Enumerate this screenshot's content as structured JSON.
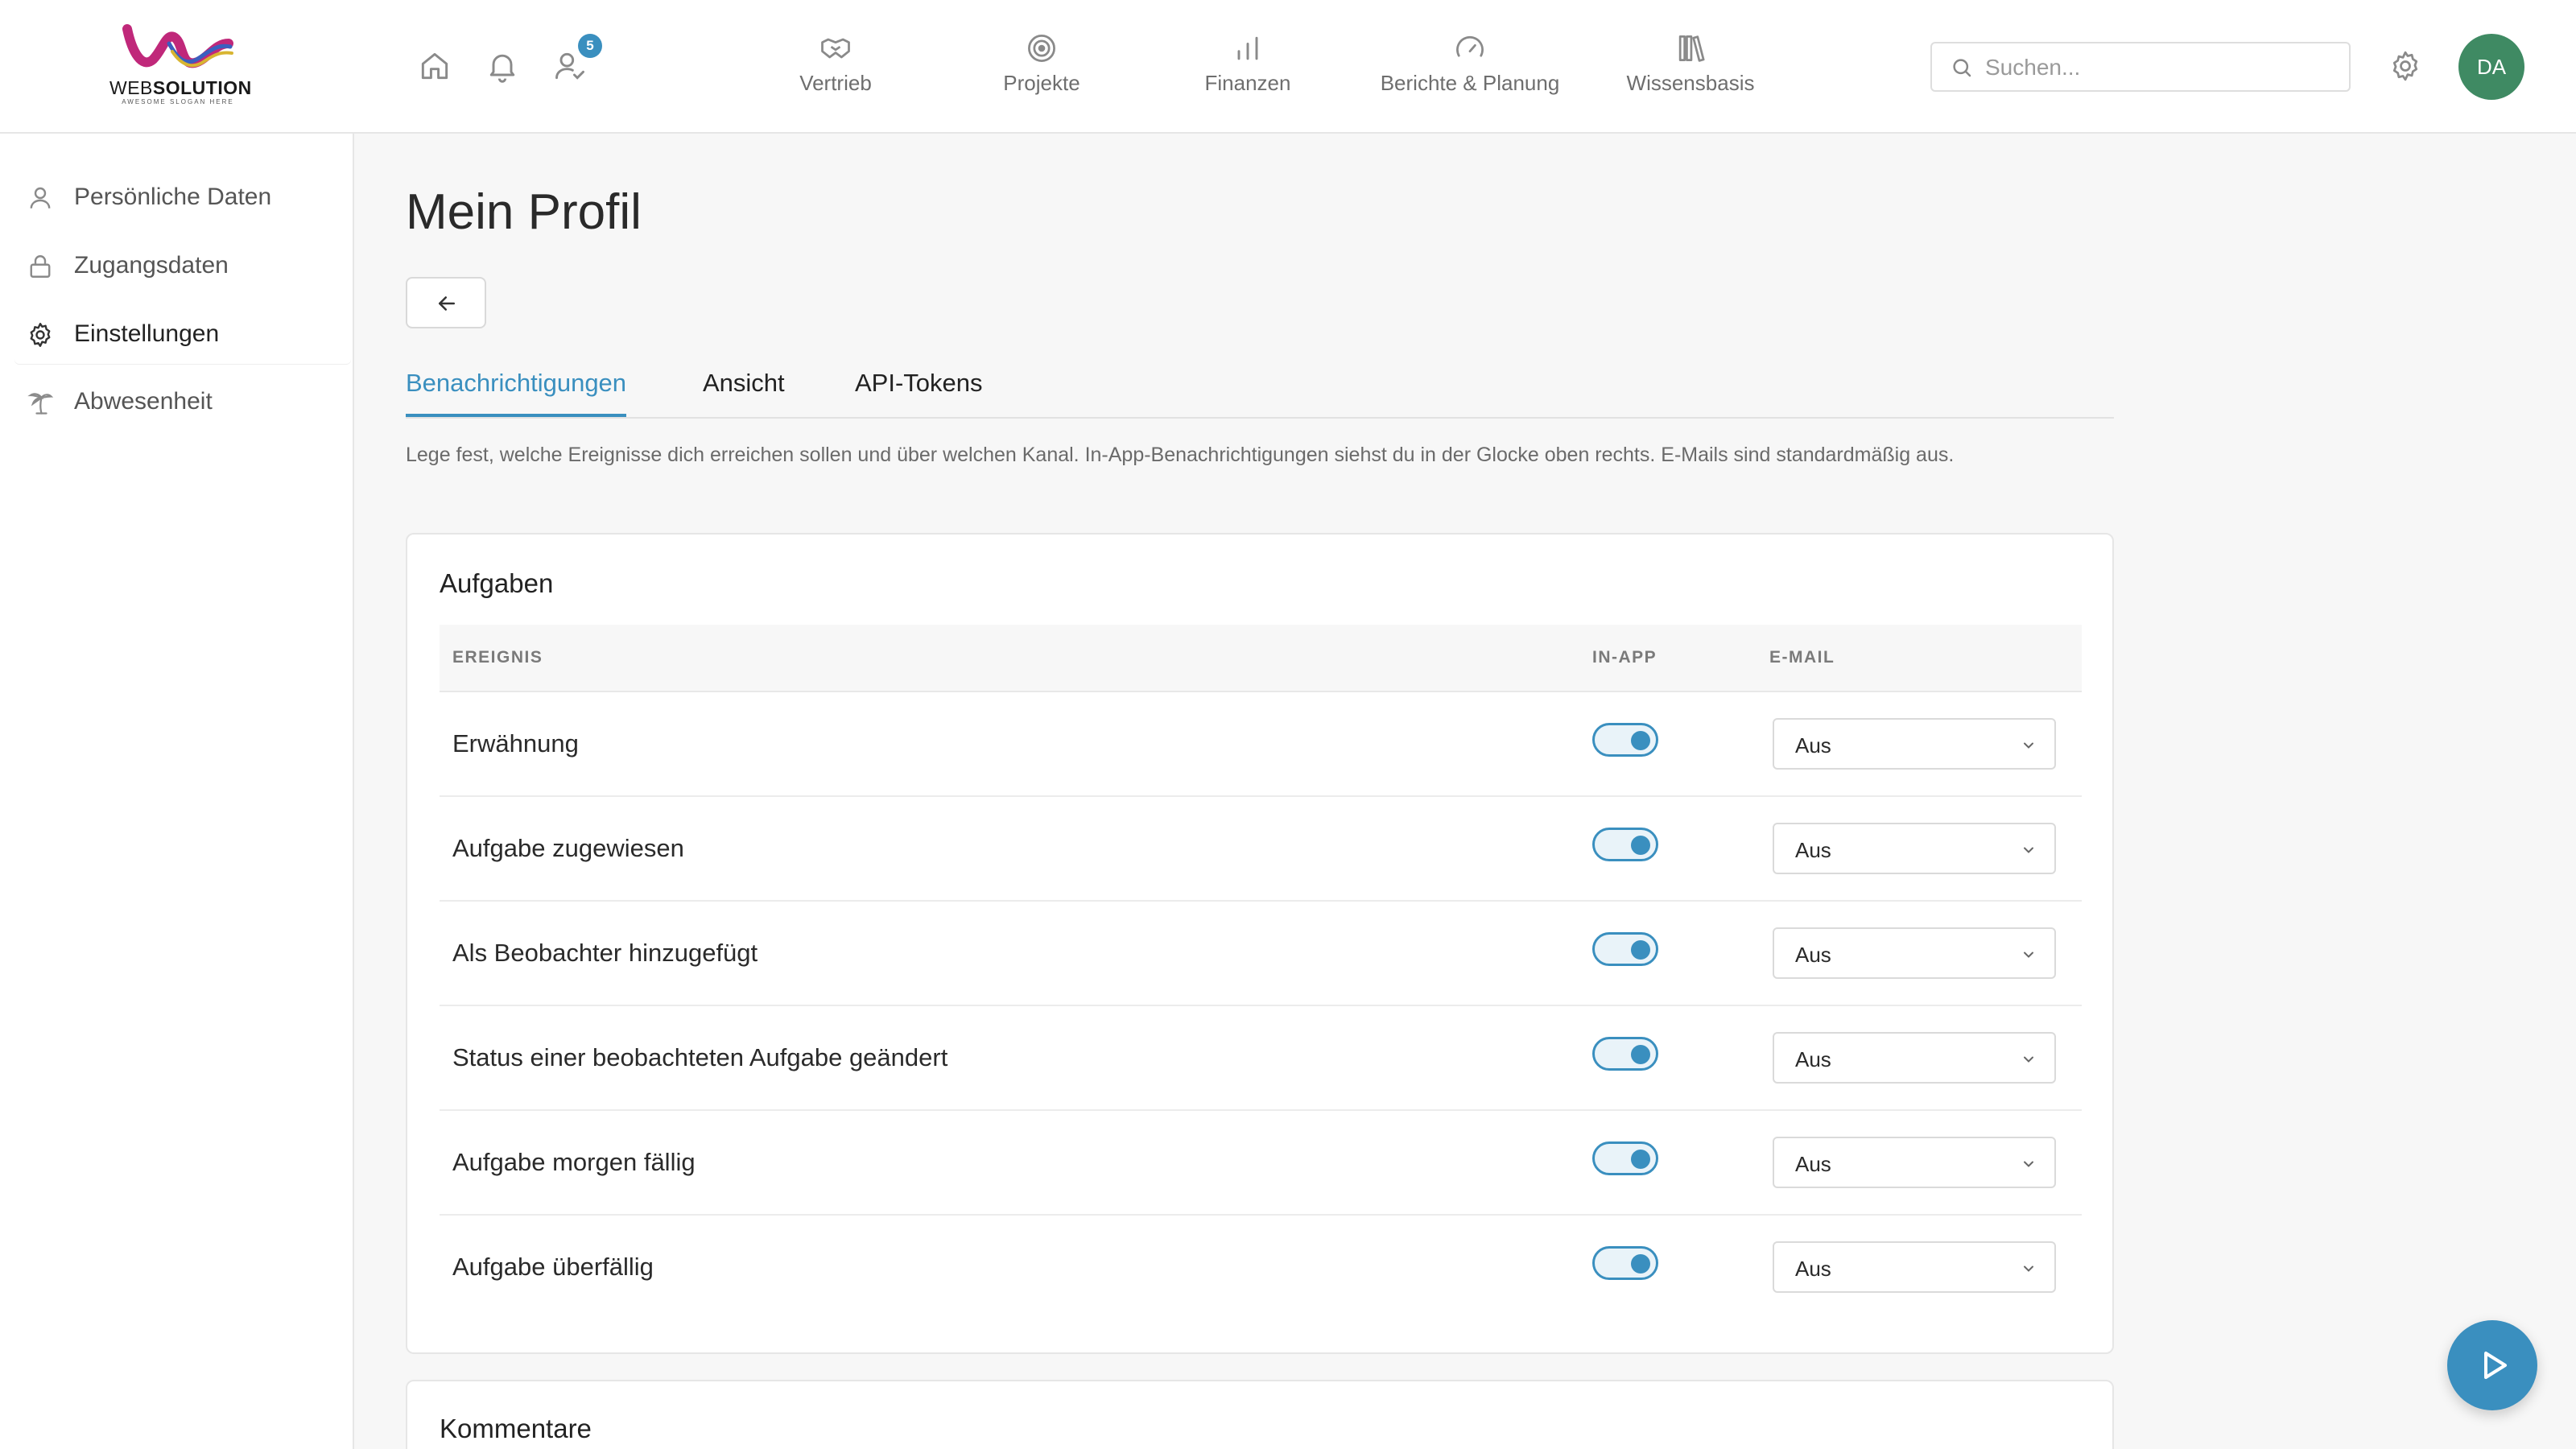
{
  "brand": {
    "name_part1": "WEB",
    "name_part2": "SOLUTION",
    "tagline": "AWESOME SLOGAN HERE",
    "colors": {
      "accent": "#3a8fbf",
      "avatar": "#3f8a63"
    }
  },
  "topbar": {
    "icons": [
      "home-icon",
      "bell-icon",
      "user-check-icon"
    ],
    "assignments_badge": "5",
    "nav": [
      {
        "label": "Vertrieb",
        "icon": "handshake-icon"
      },
      {
        "label": "Projekte",
        "icon": "target-icon"
      },
      {
        "label": "Finanzen",
        "icon": "bar-chart-icon"
      },
      {
        "label": "Berichte & Planung",
        "icon": "gauge-icon"
      },
      {
        "label": "Wissensbasis",
        "icon": "library-icon"
      }
    ],
    "search": {
      "placeholder": "Suchen...",
      "value": ""
    },
    "avatar_initials": "DA"
  },
  "sidebar": {
    "items": [
      {
        "label": "Persönliche Daten",
        "icon": "user-icon",
        "active": false
      },
      {
        "label": "Zugangsdaten",
        "icon": "lock-icon",
        "active": false
      },
      {
        "label": "Einstellungen",
        "icon": "gear-icon",
        "active": true
      },
      {
        "label": "Abwesenheit",
        "icon": "palm-tree-icon",
        "active": false
      }
    ]
  },
  "main": {
    "title": "Mein Profil",
    "tabs": [
      {
        "label": "Benachrichtigungen",
        "active": true
      },
      {
        "label": "Ansicht",
        "active": false
      },
      {
        "label": "API-Tokens",
        "active": false
      }
    ],
    "intro": "Lege fest, welche Ereignisse dich erreichen sollen und über welchen Kanal. In-App-Benachrichtigungen siehst du in der Glocke oben rechts. E-Mails sind standardmäßig aus.",
    "sections": [
      {
        "title": "Aufgaben",
        "columns": {
          "event": "EREIGNIS",
          "inapp": "IN-APP",
          "email": "E-MAIL"
        },
        "rows": [
          {
            "event": "Erwähnung",
            "inapp": true,
            "email": "Aus"
          },
          {
            "event": "Aufgabe zugewiesen",
            "inapp": true,
            "email": "Aus"
          },
          {
            "event": "Als Beobachter hinzugefügt",
            "inapp": true,
            "email": "Aus"
          },
          {
            "event": "Status einer beobachteten Aufgabe geändert",
            "inapp": true,
            "email": "Aus"
          },
          {
            "event": "Aufgabe morgen fällig",
            "inapp": true,
            "email": "Aus"
          },
          {
            "event": "Aufgabe überfällig",
            "inapp": true,
            "email": "Aus"
          }
        ]
      },
      {
        "title": "Kommentare"
      }
    ]
  }
}
